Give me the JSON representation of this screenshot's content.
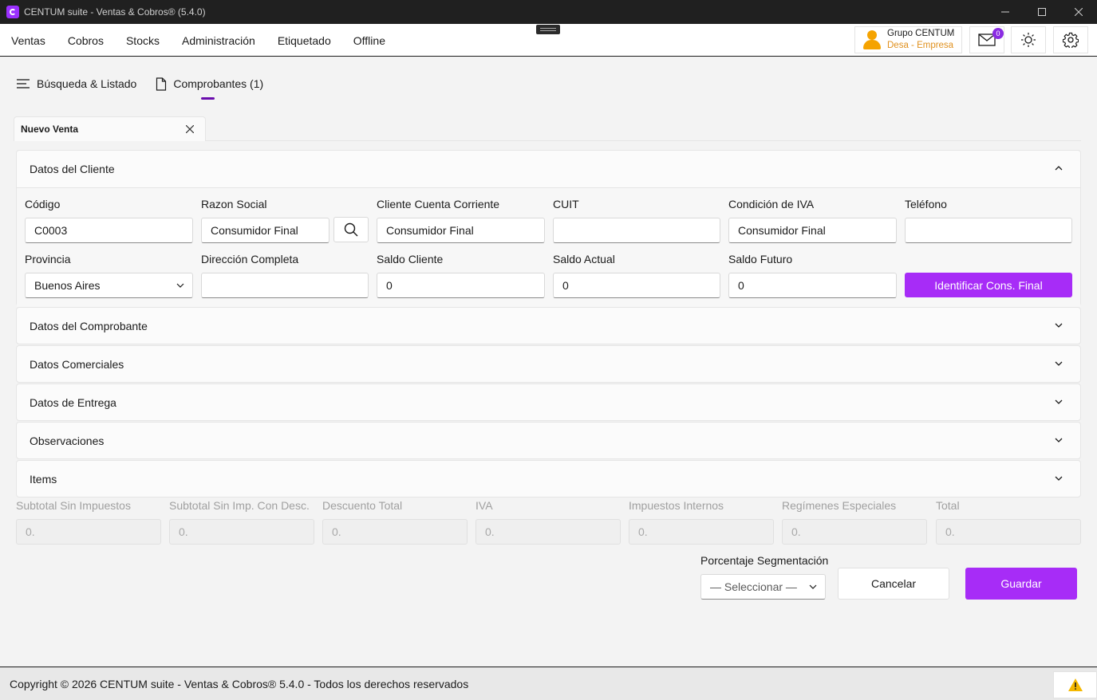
{
  "window": {
    "title": "CENTUM suite - Ventas & Cobros® (5.4.0)"
  },
  "menu": {
    "items": [
      {
        "label": "Ventas"
      },
      {
        "label": "Cobros"
      },
      {
        "label": "Stocks"
      },
      {
        "label": "Administración"
      },
      {
        "label": "Etiquetado"
      },
      {
        "label": "Offline"
      }
    ]
  },
  "user": {
    "name": "Grupo CENTUM",
    "company": "Desa - Empresa",
    "mail_count": "0"
  },
  "tabs": [
    {
      "label": "Búsqueda & Listado"
    },
    {
      "label": "Comprobantes (1)"
    }
  ],
  "doc_tab": {
    "label": "Nuevo Venta"
  },
  "sections": {
    "cliente": "Datos del Cliente",
    "comprobante": "Datos del Comprobante",
    "comerciales": "Datos Comerciales",
    "entrega": "Datos de Entrega",
    "observaciones": "Observaciones",
    "items": "Items"
  },
  "cliente": {
    "codigo": {
      "label": "Código",
      "value": "C0003"
    },
    "razon_social": {
      "label": "Razon Social",
      "value": "Consumidor Final"
    },
    "cta_cte": {
      "label": "Cliente Cuenta Corriente",
      "value": "Consumidor Final"
    },
    "cuit": {
      "label": "CUIT",
      "value": ""
    },
    "cond_iva": {
      "label": "Condición de IVA",
      "value": "Consumidor Final"
    },
    "telefono": {
      "label": "Teléfono",
      "value": ""
    },
    "provincia": {
      "label": "Provincia",
      "value": "Buenos Aires"
    },
    "direccion": {
      "label": "Dirección Completa",
      "value": ""
    },
    "saldo_cliente": {
      "label": "Saldo Cliente",
      "value": "0"
    },
    "saldo_actual": {
      "label": "Saldo Actual",
      "value": "0"
    },
    "saldo_futuro": {
      "label": "Saldo Futuro",
      "value": "0"
    },
    "identificar_btn": "Identificar Cons. Final"
  },
  "totals": [
    {
      "label": "Subtotal Sin Impuestos",
      "value": "0."
    },
    {
      "label": "Subtotal Sin Imp. Con Desc.",
      "value": "0."
    },
    {
      "label": "Descuento Total",
      "value": "0."
    },
    {
      "label": "IVA",
      "value": "0."
    },
    {
      "label": "Impuestos Internos",
      "value": "0."
    },
    {
      "label": "Regímenes Especiales",
      "value": "0."
    },
    {
      "label": "Total",
      "value": "0."
    }
  ],
  "segmentacion": {
    "label": "Porcentaje Segmentación",
    "placeholder": "— Seleccionar —"
  },
  "actions": {
    "cancel": "Cancelar",
    "save": "Guardar"
  },
  "footer": {
    "copyright": "Copyright © 2026 CENTUM suite - Ventas & Cobros® 5.4.0 - Todos los derechos reservados"
  },
  "colors": {
    "accent": "#a72cf7",
    "tab_indicator": "#6a0dad",
    "warning": "#f5b800",
    "user_company": "#e0911f"
  }
}
